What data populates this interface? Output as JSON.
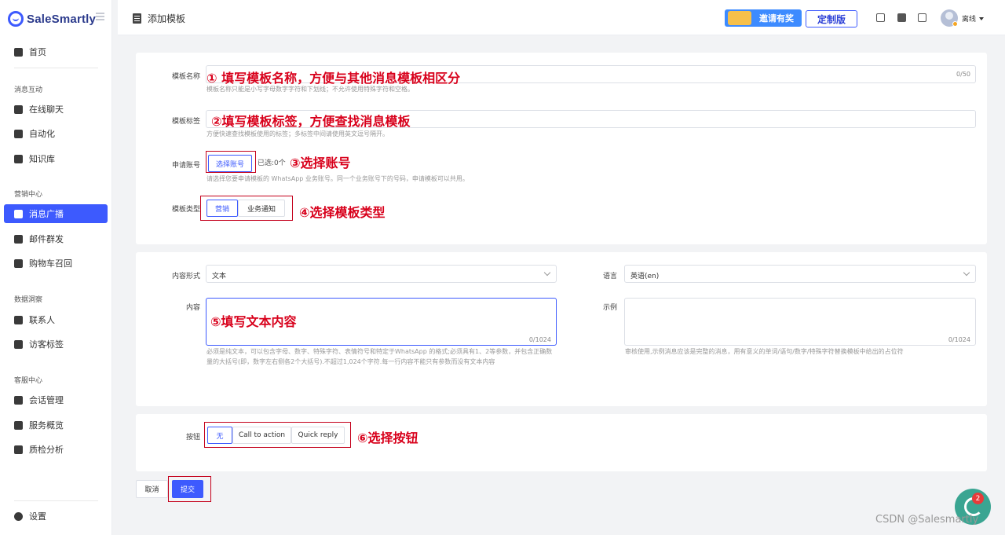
{
  "brand": {
    "name": "SaleSmartly"
  },
  "sidebar": {
    "home": "首页",
    "sections": [
      {
        "title": "消息互动",
        "items": [
          "在线聊天",
          "自动化",
          "知识库"
        ]
      },
      {
        "title": "营销中心",
        "items": [
          "消息广播",
          "邮件群发",
          "购物车召回"
        ]
      },
      {
        "title": "数据洞察",
        "items": [
          "联系人",
          "访客标签"
        ]
      },
      {
        "title": "客服中心",
        "items": [
          "会话管理",
          "服务概览",
          "质检分析"
        ]
      }
    ],
    "settings": "设置"
  },
  "header": {
    "title": "添加模板",
    "invite": "邀请有奖",
    "custom": "定制版",
    "user_status": "离线"
  },
  "form": {
    "name_label": "模板名称",
    "name_counter": "0/50",
    "name_hint": "模板名称只能是小写字母数字字符和下划线；不允许使用特殊字符和空格。",
    "tag_label": "模板标签",
    "tag_hint": "方便快速查找模板使用的标签；多标签中间请使用英文逗号隔开。",
    "account_label": "申请账号",
    "account_button": "选择账号",
    "account_selected": "已选:0个",
    "account_hint": "请选择您要申请模板的 WhatsApp 业务账号。同一个业务账号下的号码，申请模板可以共用。",
    "type_label": "模板类型",
    "type_options": [
      "营销",
      "业务通知"
    ],
    "content_type_label": "内容形式",
    "content_type_value": "文本",
    "language_label": "语言",
    "language_value": "英语(en)",
    "content_label": "内容",
    "content_counter": "0/1024",
    "content_hint": "必须是纯文本，可以包含字母、数字、特殊字符、表情符号和特定于WhatsApp 的格式;必须具有1、2等参数，并包含正确数量的大括号(即，数字左右侧各2个大括号).不超过1,024个字符.每一行内容不能只有参数而没有文本内容",
    "example_label": "示例",
    "example_counter": "0/1024",
    "example_hint": "审核使用,示例消息应该是完整的消息，用有意义的单词/语句/数字/特殊字符替换模板中给出的占位符",
    "button_label": "按钮",
    "button_options": [
      "无",
      "Call to action",
      "Quick reply"
    ],
    "cancel": "取消",
    "submit": "提交"
  },
  "annotations": {
    "a1": "① 填写模板名称，方便与其他消息模板相区分",
    "a2": "②填写模板标签，方便查找消息模板",
    "a3": "③选择账号",
    "a4": "④选择模板类型",
    "a5": "⑤填写文本内容",
    "a6": "⑥选择按钮"
  },
  "chat_badge": "2",
  "watermark": "CSDN @Salesmartly",
  "colors": {
    "accent": "#3d5afe",
    "annotation": "#d8001b"
  }
}
